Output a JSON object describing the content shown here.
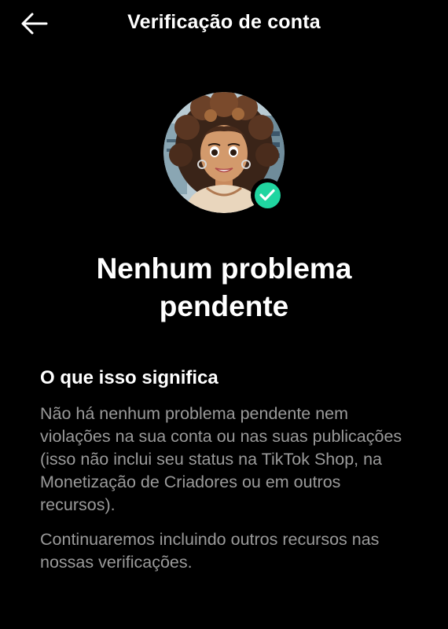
{
  "header": {
    "back_icon": "arrow-left-icon",
    "title": "Verificação de conta"
  },
  "profile": {
    "badge_icon": "check-icon",
    "badge_color": "#20d5a0"
  },
  "status": {
    "headline": "Nenhum problema pendente"
  },
  "explanation": {
    "title": "O que isso significa",
    "paragraph1": "Não há nenhum problema pendente nem violações na sua conta ou nas suas publicações (isso não inclui seu status na TikTok Shop, na Monetização de Criadores ou em outros recursos).",
    "paragraph2": "Continuaremos incluindo outros recursos nas nossas verificações."
  },
  "colors": {
    "background": "#000000",
    "text_primary": "#ffffff",
    "text_secondary": "#9a9a9a"
  }
}
